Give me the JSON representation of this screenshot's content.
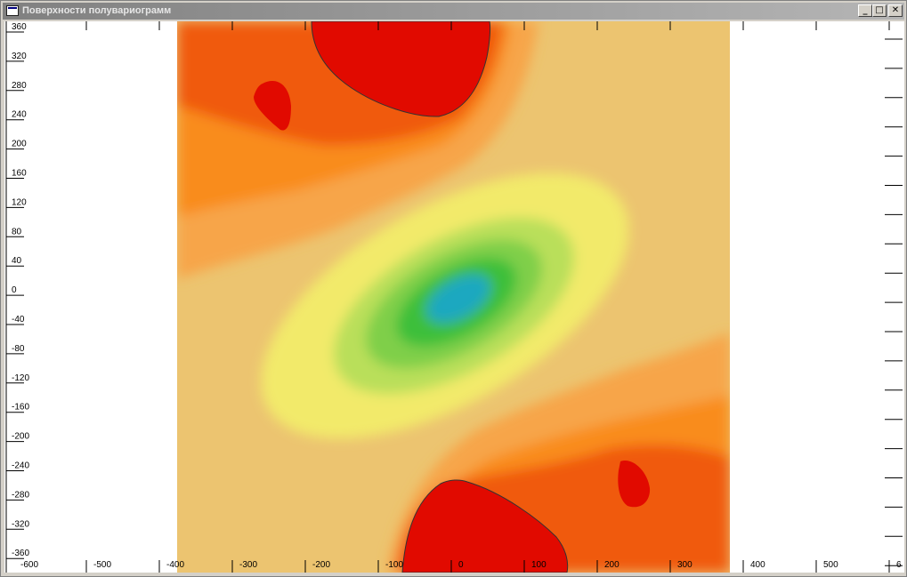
{
  "window": {
    "title": "Поверхности полувариограмм",
    "controls": {
      "minimize_icon": "minimize-icon",
      "maximize_icon": "maximize-icon",
      "close_icon": "close-icon"
    }
  },
  "axes": {
    "y_ticks": [
      "360",
      "320",
      "280",
      "240",
      "200",
      "160",
      "120",
      "80",
      "40",
      "0",
      "-40",
      "-80",
      "-120",
      "-160",
      "-200",
      "-240",
      "-280",
      "-320",
      "-360"
    ],
    "x_ticks": [
      "-600",
      "-500",
      "-400",
      "-300",
      "-200",
      "-100",
      "0",
      "100",
      "200",
      "300",
      "400",
      "500",
      "6"
    ]
  },
  "colors": {
    "low": "#1aa8c0",
    "mid_green": "#3cbf3a",
    "yellow": "#f2ea6a",
    "tan": "#ecc470",
    "orange": "#f98c1c",
    "red": "#e10a00"
  }
}
